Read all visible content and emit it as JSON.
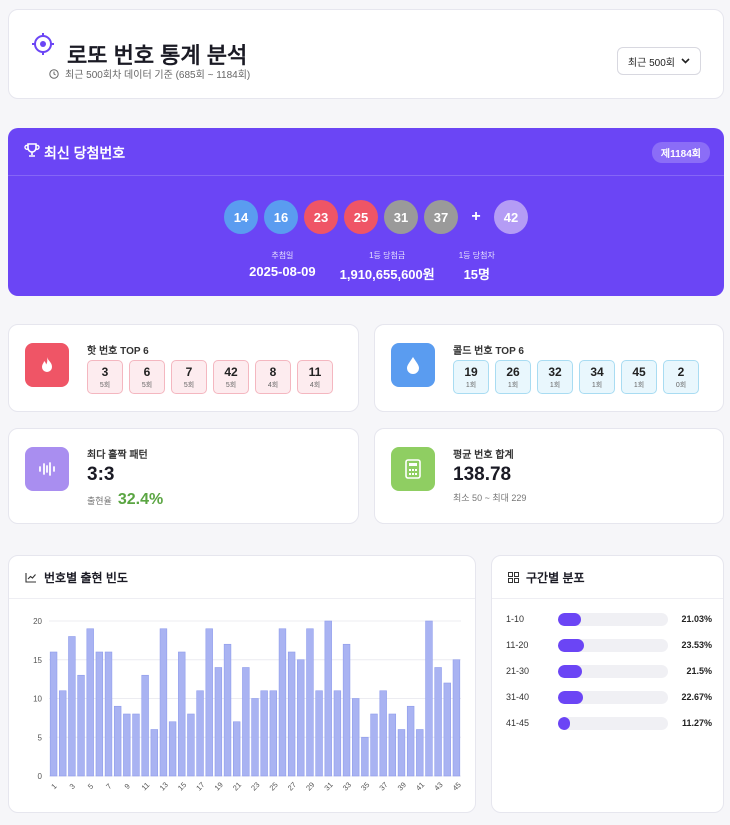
{
  "header": {
    "title": "로또 번호 통계 분석",
    "subtitle": "최근 500회차 데이터 기준 (685회 ~ 1184회)",
    "range_button": "최근 500회"
  },
  "latest": {
    "title": "최신 당첨번호",
    "round": "제1184회",
    "numbers": [
      {
        "value": "14",
        "color": "#5a9cf0"
      },
      {
        "value": "16",
        "color": "#5a9cf0"
      },
      {
        "value": "23",
        "color": "#ef5566"
      },
      {
        "value": "25",
        "color": "#ef5566"
      },
      {
        "value": "31",
        "color": "#9a9a9a"
      },
      {
        "value": "37",
        "color": "#9a9a9a"
      }
    ],
    "plus": "+",
    "bonus": {
      "value": "42",
      "color": "#b49cf5"
    },
    "draw_date_label": "추첨일",
    "draw_date": "2025-08-09",
    "prize_label": "1등 당첨금",
    "prize": "1,910,655,600원",
    "winners_label": "1등 당첨자",
    "winners": "15명"
  },
  "hot": {
    "title": "핫 번호 TOP 6",
    "items": [
      {
        "n": "3",
        "c": "5회"
      },
      {
        "n": "6",
        "c": "5회"
      },
      {
        "n": "7",
        "c": "5회"
      },
      {
        "n": "42",
        "c": "5회"
      },
      {
        "n": "8",
        "c": "4회"
      },
      {
        "n": "11",
        "c": "4회"
      }
    ]
  },
  "cold": {
    "title": "콜드 번호 TOP 6",
    "items": [
      {
        "n": "19",
        "c": "1회"
      },
      {
        "n": "26",
        "c": "1회"
      },
      {
        "n": "32",
        "c": "1회"
      },
      {
        "n": "34",
        "c": "1회"
      },
      {
        "n": "45",
        "c": "1회"
      },
      {
        "n": "2",
        "c": "0회"
      }
    ]
  },
  "oddeven": {
    "title": "최다 홀짝 패턴",
    "value": "3:3",
    "rate_label": "출현율",
    "rate": "32.4%"
  },
  "sum": {
    "title": "평균 번호 합계",
    "value": "138.78",
    "range": "최소 50 ~ 최대 229"
  },
  "frequency": {
    "title": "번호별 출현 빈도"
  },
  "distribution": {
    "title": "구간별 분포",
    "rows": [
      {
        "label": "1-10",
        "pct": "21.03%",
        "value": 21.03
      },
      {
        "label": "11-20",
        "pct": "23.53%",
        "value": 23.53
      },
      {
        "label": "21-30",
        "pct": "21.5%",
        "value": 21.5
      },
      {
        "label": "31-40",
        "pct": "22.67%",
        "value": 22.67
      },
      {
        "label": "41-45",
        "pct": "11.27%",
        "value": 11.27
      }
    ]
  },
  "colors": {
    "accent": "#6b45f5",
    "hot": "#ef5566",
    "cold": "#5a9cf0",
    "pattern": "#a98ef0",
    "sum": "#8fce62",
    "bar": "#a9b3f2"
  },
  "chart_data": {
    "type": "bar",
    "categories": [
      1,
      2,
      3,
      4,
      5,
      6,
      7,
      8,
      9,
      10,
      11,
      12,
      13,
      14,
      15,
      16,
      17,
      18,
      19,
      20,
      21,
      22,
      23,
      24,
      25,
      26,
      27,
      28,
      29,
      30,
      31,
      32,
      33,
      34,
      35,
      36,
      37,
      38,
      39,
      40,
      41,
      42,
      43,
      44,
      45
    ],
    "x_tick_labels": [
      "1",
      "3",
      "5",
      "7",
      "9",
      "11",
      "13",
      "15",
      "17",
      "19",
      "21",
      "23",
      "25",
      "27",
      "29",
      "31",
      "33",
      "35",
      "37",
      "39",
      "41",
      "43",
      "45"
    ],
    "values": [
      16,
      11,
      18,
      13,
      19,
      16,
      16,
      9,
      8,
      8,
      13,
      6,
      19,
      7,
      16,
      8,
      11,
      19,
      14,
      17,
      7,
      14,
      10,
      11,
      11,
      19,
      16,
      15,
      19,
      11,
      20,
      11,
      17,
      10,
      5,
      8,
      11,
      8,
      6,
      9,
      6,
      20,
      14,
      12,
      15
    ],
    "ylim": [
      0,
      20
    ],
    "y_ticks": [
      0,
      5,
      10,
      15,
      20
    ],
    "grid": true
  }
}
